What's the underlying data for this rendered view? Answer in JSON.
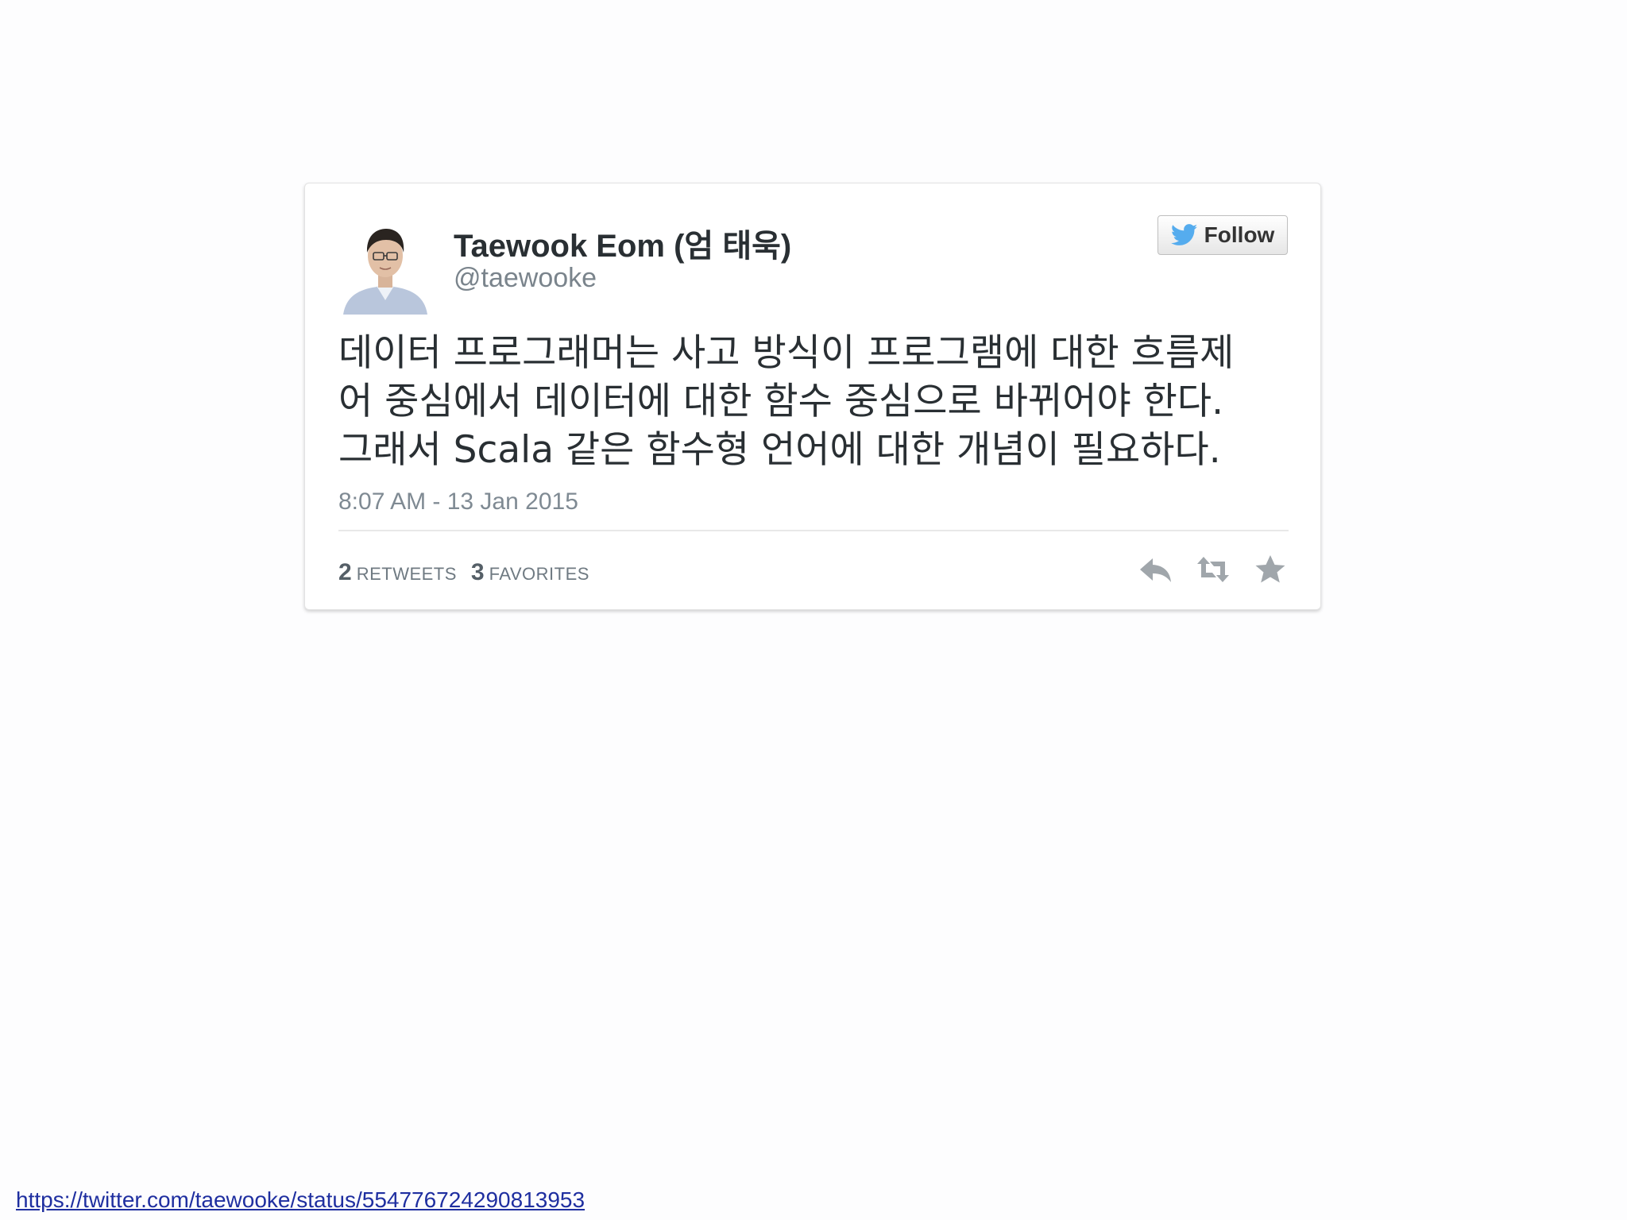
{
  "tweet": {
    "display_name": "Taewook Eom (엄 태욱)",
    "screen_name": "@taewooke",
    "follow_label": "Follow",
    "text_lines": [
      "데이터 프로그래머는 사고 방식이 프로그램에 대한 흐름제",
      "어 중심에서 데이터에 대한 함수 중심으로 바뀌어야 한다.",
      "그래서 Scala 같은 함수형 언어에 대한 개념이 필요하다."
    ],
    "timestamp": "8:07 AM - 13 Jan 2015",
    "retweets": {
      "count": "2",
      "label": "Retweets"
    },
    "favorites": {
      "count": "3",
      "label": "Favorites"
    },
    "icons": {
      "avatar": "avatar-photo",
      "follow": "twitter-bird-icon",
      "reply": "reply-icon",
      "retweet": "retweet-icon",
      "favorite": "star-icon"
    },
    "colors": {
      "follow_bird": "#55acee",
      "action_icons": "#a0a6ab"
    }
  },
  "source_link": {
    "text": "https://twitter.com/taewooke/status/554776724290813953"
  }
}
